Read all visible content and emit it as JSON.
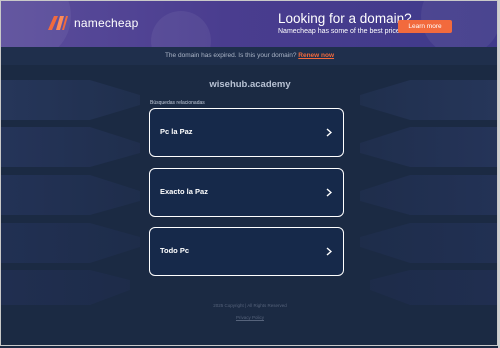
{
  "banner": {
    "logo_icon": "namecheap-logo-icon",
    "logo_text": "namecheap",
    "promo_title": "Looking for a domain?",
    "promo_subtitle": "Namecheap has some of the best prices.",
    "cta_label": "Learn more"
  },
  "notice": {
    "text": "The domain has expired. Is this your domain?",
    "renew_link": "Renew now"
  },
  "main": {
    "domain_name": "wisehub.academy",
    "related_label": "Búsquedas relacionadas",
    "links": [
      {
        "label": "Pc la Paz",
        "icon": "chevron-right-icon"
      },
      {
        "label": "Exacto la Paz",
        "icon": "chevron-right-icon"
      },
      {
        "label": "Todo Pc",
        "icon": "chevron-right-icon"
      }
    ]
  },
  "footer": {
    "copyright": "2025 Copyright | All Rights Reserved",
    "privacy": "Privacy Policy"
  },
  "colors": {
    "background": "#1b2a43",
    "banner": "#4a3d8f",
    "accent": "#f26a3d",
    "card": "#16294a"
  }
}
